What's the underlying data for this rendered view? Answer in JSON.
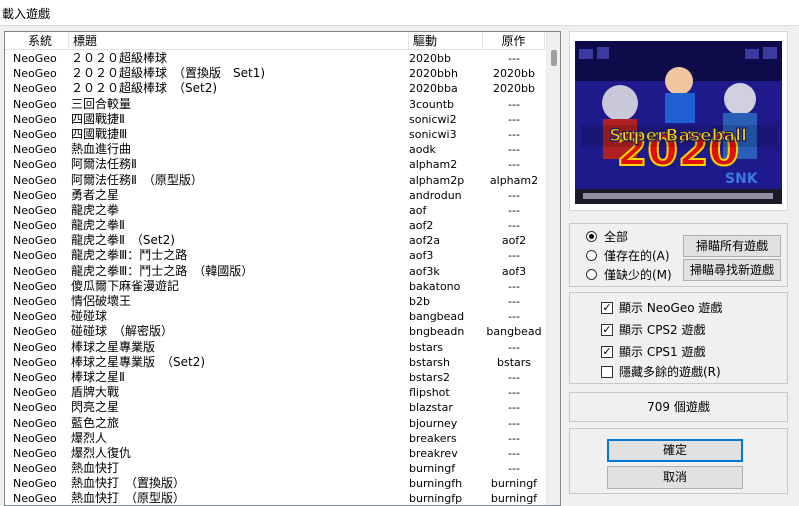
{
  "window": {
    "title": "載入遊戲"
  },
  "list": {
    "columns": {
      "system": "系統",
      "title": "標題",
      "driver": "驅動",
      "original": "原作"
    },
    "rows": [
      {
        "system": "NeoGeo",
        "title": "２０２０超級棒球",
        "driver": "2020bb",
        "original": "---"
      },
      {
        "system": "NeoGeo",
        "title": "２０２０超級棒球　（置換版　Set1)",
        "driver": "2020bbh",
        "original": "2020bb"
      },
      {
        "system": "NeoGeo",
        "title": "２０２０超級棒球　（Set2)",
        "driver": "2020bba",
        "original": "2020bb"
      },
      {
        "system": "NeoGeo",
        "title": "三回合較量",
        "driver": "3countb",
        "original": "---"
      },
      {
        "system": "NeoGeo",
        "title": "四國戰捷Ⅱ",
        "driver": "sonicwi2",
        "original": "---"
      },
      {
        "system": "NeoGeo",
        "title": "四國戰捷Ⅲ",
        "driver": "sonicwi3",
        "original": "---"
      },
      {
        "system": "NeoGeo",
        "title": "熱血進行曲",
        "driver": "aodk",
        "original": "---"
      },
      {
        "system": "NeoGeo",
        "title": "阿爾法任務Ⅱ",
        "driver": "alpham2",
        "original": "---"
      },
      {
        "system": "NeoGeo",
        "title": "阿爾法任務Ⅱ　（原型版）",
        "driver": "alpham2p",
        "original": "alpham2"
      },
      {
        "system": "NeoGeo",
        "title": "勇者之星",
        "driver": "androdun",
        "original": "---"
      },
      {
        "system": "NeoGeo",
        "title": "龍虎之拳",
        "driver": "aof",
        "original": "---"
      },
      {
        "system": "NeoGeo",
        "title": "龍虎之拳Ⅱ",
        "driver": "aof2",
        "original": "---"
      },
      {
        "system": "NeoGeo",
        "title": "龍虎之拳Ⅱ　（Set2)",
        "driver": "aof2a",
        "original": "aof2"
      },
      {
        "system": "NeoGeo",
        "title": "龍虎之拳Ⅲ：鬥士之路",
        "driver": "aof3",
        "original": "---"
      },
      {
        "system": "NeoGeo",
        "title": "龍虎之拳Ⅲ：鬥士之路　（韓國版）",
        "driver": "aof3k",
        "original": "aof3"
      },
      {
        "system": "NeoGeo",
        "title": "傻瓜爾下麻雀漫遊記",
        "driver": "bakatono",
        "original": "---"
      },
      {
        "system": "NeoGeo",
        "title": "情侶破壞王",
        "driver": "b2b",
        "original": "---"
      },
      {
        "system": "NeoGeo",
        "title": "碰碰球",
        "driver": "bangbead",
        "original": "---"
      },
      {
        "system": "NeoGeo",
        "title": "碰碰球　（解密版）",
        "driver": "bngbeadn",
        "original": "bangbead"
      },
      {
        "system": "NeoGeo",
        "title": "棒球之星專業版",
        "driver": "bstars",
        "original": "---"
      },
      {
        "system": "NeoGeo",
        "title": "棒球之星專業版　（Set2)",
        "driver": "bstarsh",
        "original": "bstars"
      },
      {
        "system": "NeoGeo",
        "title": "棒球之星Ⅱ",
        "driver": "bstars2",
        "original": "---"
      },
      {
        "system": "NeoGeo",
        "title": "盾牌大戰",
        "driver": "flipshot",
        "original": "---"
      },
      {
        "system": "NeoGeo",
        "title": "閃亮之星",
        "driver": "blazstar",
        "original": "---"
      },
      {
        "system": "NeoGeo",
        "title": "藍色之旅",
        "driver": "bjourney",
        "original": "---"
      },
      {
        "system": "NeoGeo",
        "title": "爆烈人",
        "driver": "breakers",
        "original": "---"
      },
      {
        "system": "NeoGeo",
        "title": "爆烈人復仇",
        "driver": "breakrev",
        "original": "---"
      },
      {
        "system": "NeoGeo",
        "title": "熱血快打",
        "driver": "burningf",
        "original": "---"
      },
      {
        "system": "NeoGeo",
        "title": "熱血快打　（置換版）",
        "driver": "burningfh",
        "original": "burningf"
      },
      {
        "system": "NeoGeo",
        "title": "熱血快打　（原型版）",
        "driver": "burningfp",
        "original": "burningf"
      }
    ]
  },
  "preview": {
    "logo_text": "SuperBaseball",
    "big_number": "2020",
    "brand": "SNK"
  },
  "filter": {
    "options": [
      {
        "label": "全部",
        "selected": true
      },
      {
        "label": "僅存在的(A)",
        "selected": false
      },
      {
        "label": "僅缺少的(M)",
        "selected": false
      }
    ],
    "scan_all_label": "掃瞄所有遊戲",
    "scan_new_label": "掃瞄尋找新遊戲"
  },
  "display": {
    "options": [
      {
        "label": "顯示 NeoGeo 遊戲",
        "checked": true
      },
      {
        "label": "顯示 CPS2 遊戲",
        "checked": true
      },
      {
        "label": "顯示 CPS1 遊戲",
        "checked": true
      },
      {
        "label": "隱藏多餘的遊戲(R)",
        "checked": false
      }
    ]
  },
  "status": {
    "count_text": "709 個遊戲"
  },
  "actions": {
    "ok_label": "確定",
    "cancel_label": "取消"
  },
  "colors": {
    "focus": "#0078d7",
    "preview_sky": "#1e1a8c",
    "logo_yellow": "#ffd400"
  }
}
